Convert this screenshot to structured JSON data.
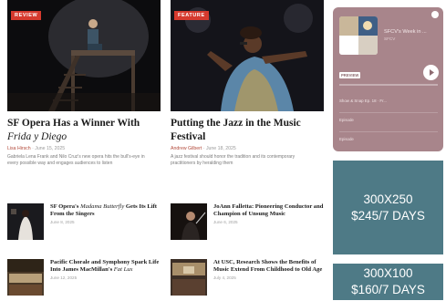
{
  "featured": [
    {
      "badge": "REVIEW",
      "title": "SF Opera Has a Winner With ",
      "title_italic": "Frida y Diego",
      "author": "Lisa Hirsch",
      "date": "June 15, 2025",
      "excerpt": "Gabriela Lena Frank and Nilo Cruz's new opera hits the bull's-eye in every possible way and engages audiences to listen"
    },
    {
      "badge": "FEATURE",
      "title": "Putting the Jazz in the Music Festival",
      "author": "Andrew Gilbert",
      "date": "June 18, 2025",
      "excerpt": "A jazz festival should honor the tradition and its contemporary practitioners by heralding them"
    }
  ],
  "stories": [
    {
      "title_a": "SF Opera's ",
      "title_italic": "Madama Butterfly",
      "title_b": " Gets Its Lift From the Singers",
      "date": "June 8, 2025"
    },
    {
      "title_a": "JoAnn Falletta: Pioneering Conductor and Champion of Unsung Music",
      "title_italic": "",
      "title_b": "",
      "date": "June 6, 2025"
    },
    {
      "title_a": "Pacific Chorale and Symphony Spark Life Into James MacMillan's ",
      "title_italic": "Fat Lux",
      "title_b": "",
      "date": "June 12, 2025"
    },
    {
      "title_a": "At USC, Research Shows the Benefits of Music Extend From Childhood to Old Age",
      "title_italic": "",
      "title_b": "",
      "date": "July 4, 2025"
    }
  ],
  "player": {
    "title": "SFCV's Week in ...",
    "subtitle": "SFCV",
    "preview_label": "PREVIEW",
    "episodes": [
      "Show & Snap Ep. 18 · Fr...",
      "Episode",
      "Episode"
    ]
  },
  "ads": [
    {
      "line1": "300X250",
      "line2": "$245/7 DAYS"
    },
    {
      "line1": "300X100",
      "line2": "$160/7 DAYS"
    }
  ],
  "colors": {
    "badge": "#d63a2e",
    "player_bg": "#a8858b",
    "ad_bg": "#4e7a86",
    "author": "#b34a3b"
  }
}
